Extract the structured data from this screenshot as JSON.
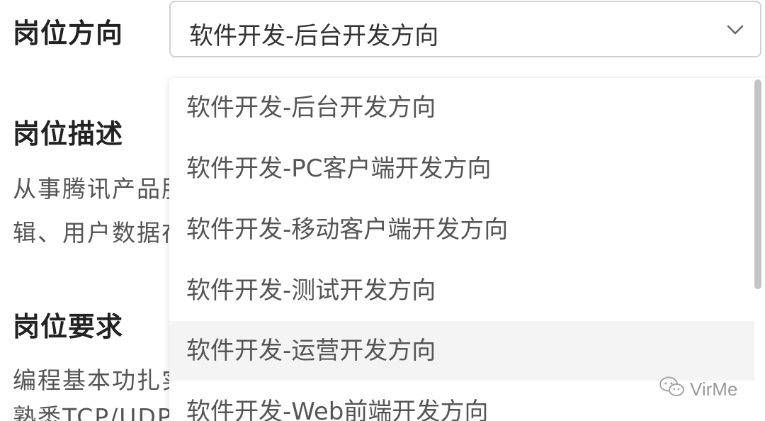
{
  "form": {
    "direction_label": "岗位方向",
    "selected_value": "软件开发-后台开发方向",
    "description_label": "岗位描述",
    "requirement_label": "岗位要求"
  },
  "description": {
    "line1_visible": "从事腾讯产品服",
    "line2_visible": "辑、用户数据在"
  },
  "requirement": {
    "line1_visible": "编程基本功扎实",
    "line2_visible": "熟悉TCP/UDP"
  },
  "dropdown": {
    "options": [
      "软件开发-后台开发方向",
      "软件开发-PC客户端开发方向",
      "软件开发-移动客户端开发方向",
      "软件开发-测试开发方向",
      "软件开发-运营开发方向",
      "软件开发-Web前端开发方向"
    ],
    "highlighted_index": 4
  },
  "watermark": {
    "text": "VirMe",
    "icon": "wechat-icon"
  },
  "colors": {
    "label": "#222222",
    "text": "#555555",
    "border": "#d2d2d2",
    "highlight": "#f4f4f4",
    "scrollbar": "#c4c4c4"
  }
}
